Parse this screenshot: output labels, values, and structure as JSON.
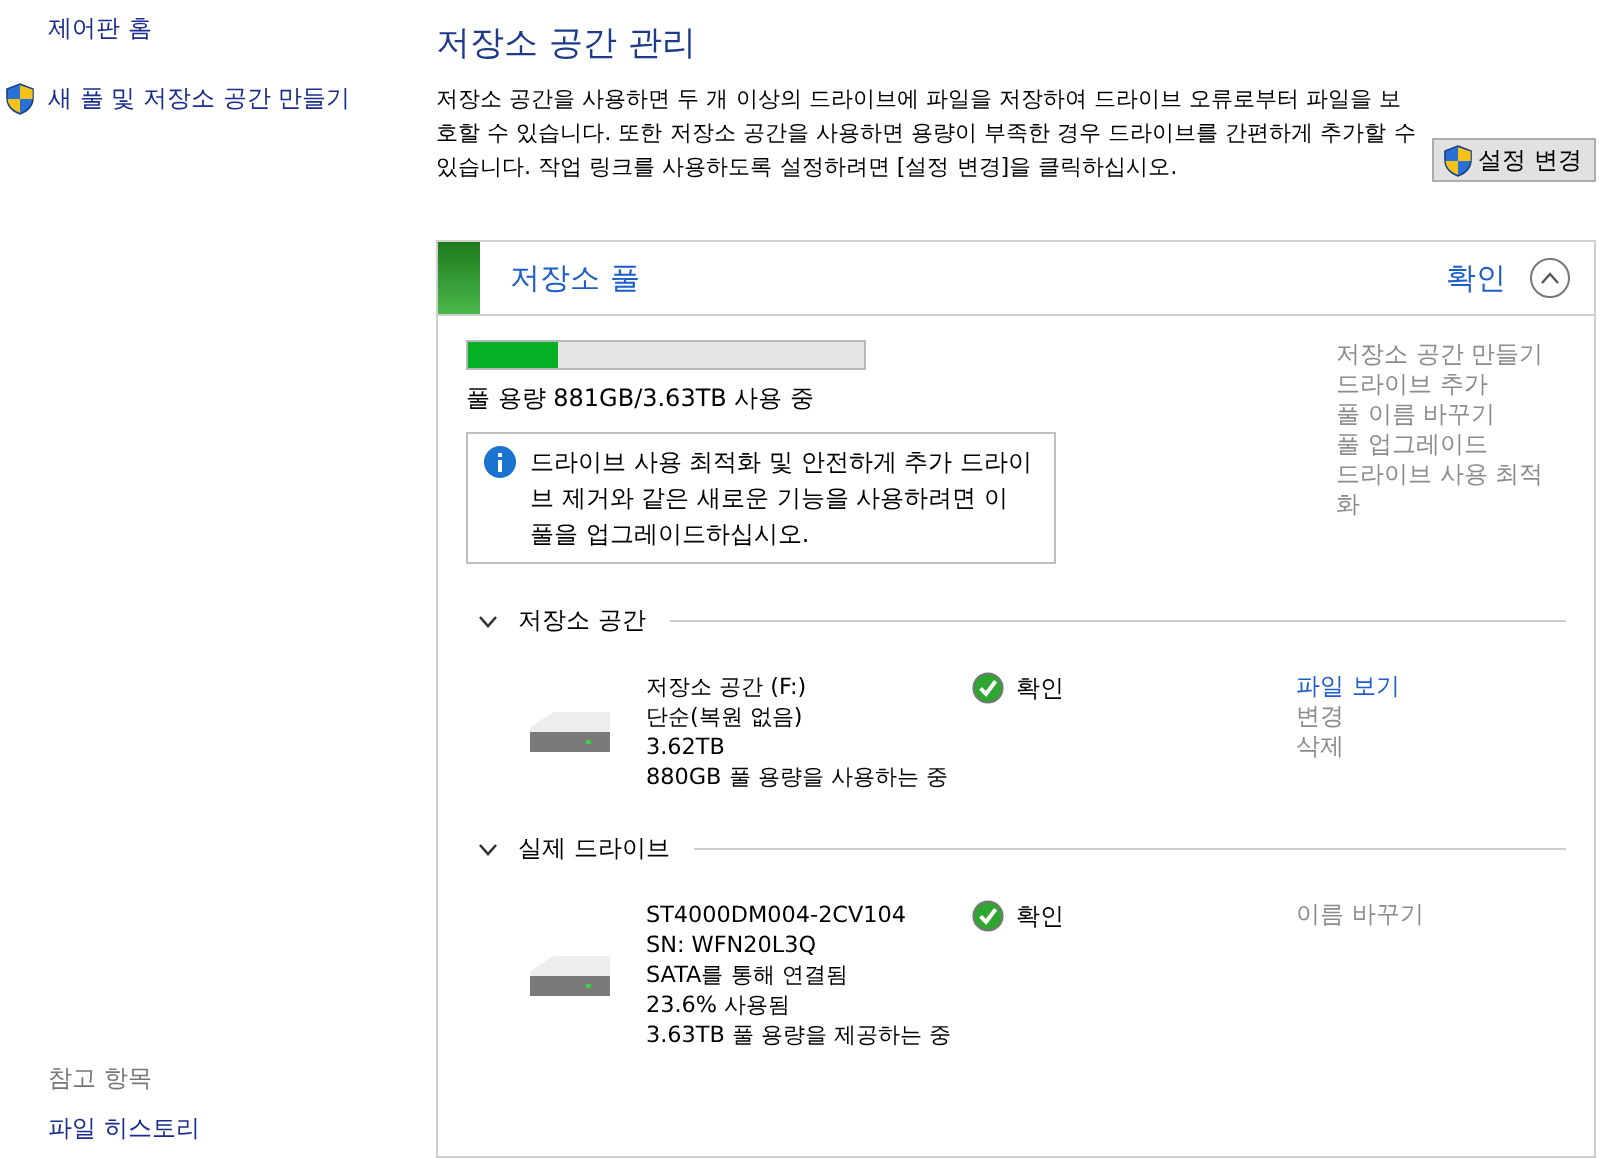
{
  "sidebar": {
    "home": "제어판 홈",
    "tasks": [
      {
        "label": "새 풀 및 저장소 공간 만들기"
      }
    ],
    "see_also": {
      "title": "참고 항목",
      "items": [
        "파일 히스토리"
      ]
    }
  },
  "main": {
    "title": "저장소 공간 관리",
    "description": "저장소 공간을 사용하면 두 개 이상의 드라이브에 파일을 저장하여 드라이브 오류로부터 파일을 보호할 수 있습니다. 또한 저장소 공간을 사용하면 용량이 부족한 경우 드라이브를 간편하게 추가할 수 있습니다. 작업 링크를 사용하도록 설정하려면 [설정 변경]을 클릭하십시오.",
    "change_settings_button": "설정 변경"
  },
  "pool": {
    "title": "저장소 풀",
    "status": "확인",
    "expanded": true,
    "usage": {
      "level": 0.225,
      "text": "풀 용량 881GB/3.63TB 사용 중"
    },
    "info": "드라이브 사용 최적화 및 안전하게 추가 드라이브 제거와 같은 새로운 기능을 사용하려면 이 풀을 업그레이드하십시오.",
    "actions": [
      {
        "label": "저장소 공간 만들기",
        "disabled": true
      },
      {
        "label": "드라이브 추가",
        "disabled": true
      },
      {
        "label": "풀 이름 바꾸기",
        "disabled": true
      },
      {
        "label": "풀 업그레이드",
        "disabled": true
      },
      {
        "label": "드라이브 사용 최적화",
        "disabled": true
      }
    ],
    "sections": [
      {
        "title": "저장소 공간",
        "expanded": true,
        "items": [
          {
            "lines": [
              "저장소 공간 (F:)",
              "단순(복원 없음)",
              "3.62TB",
              "880GB 풀 용량을 사용하는 중"
            ],
            "status": "확인",
            "actions": [
              {
                "label": "파일 보기",
                "disabled": false
              },
              {
                "label": "변경",
                "disabled": true
              },
              {
                "label": "삭제",
                "disabled": true
              }
            ]
          }
        ]
      },
      {
        "title": "실제 드라이브",
        "expanded": true,
        "items": [
          {
            "lines": [
              "ST4000DM004-2CV104",
              "SN: WFN20L3Q",
              "SATA를 통해 연결됨",
              "23.6% 사용됨",
              "3.63TB 풀 용량을 제공하는 중"
            ],
            "status": "확인",
            "actions": [
              {
                "label": "이름 바꾸기",
                "disabled": true
              }
            ]
          }
        ]
      }
    ]
  }
}
